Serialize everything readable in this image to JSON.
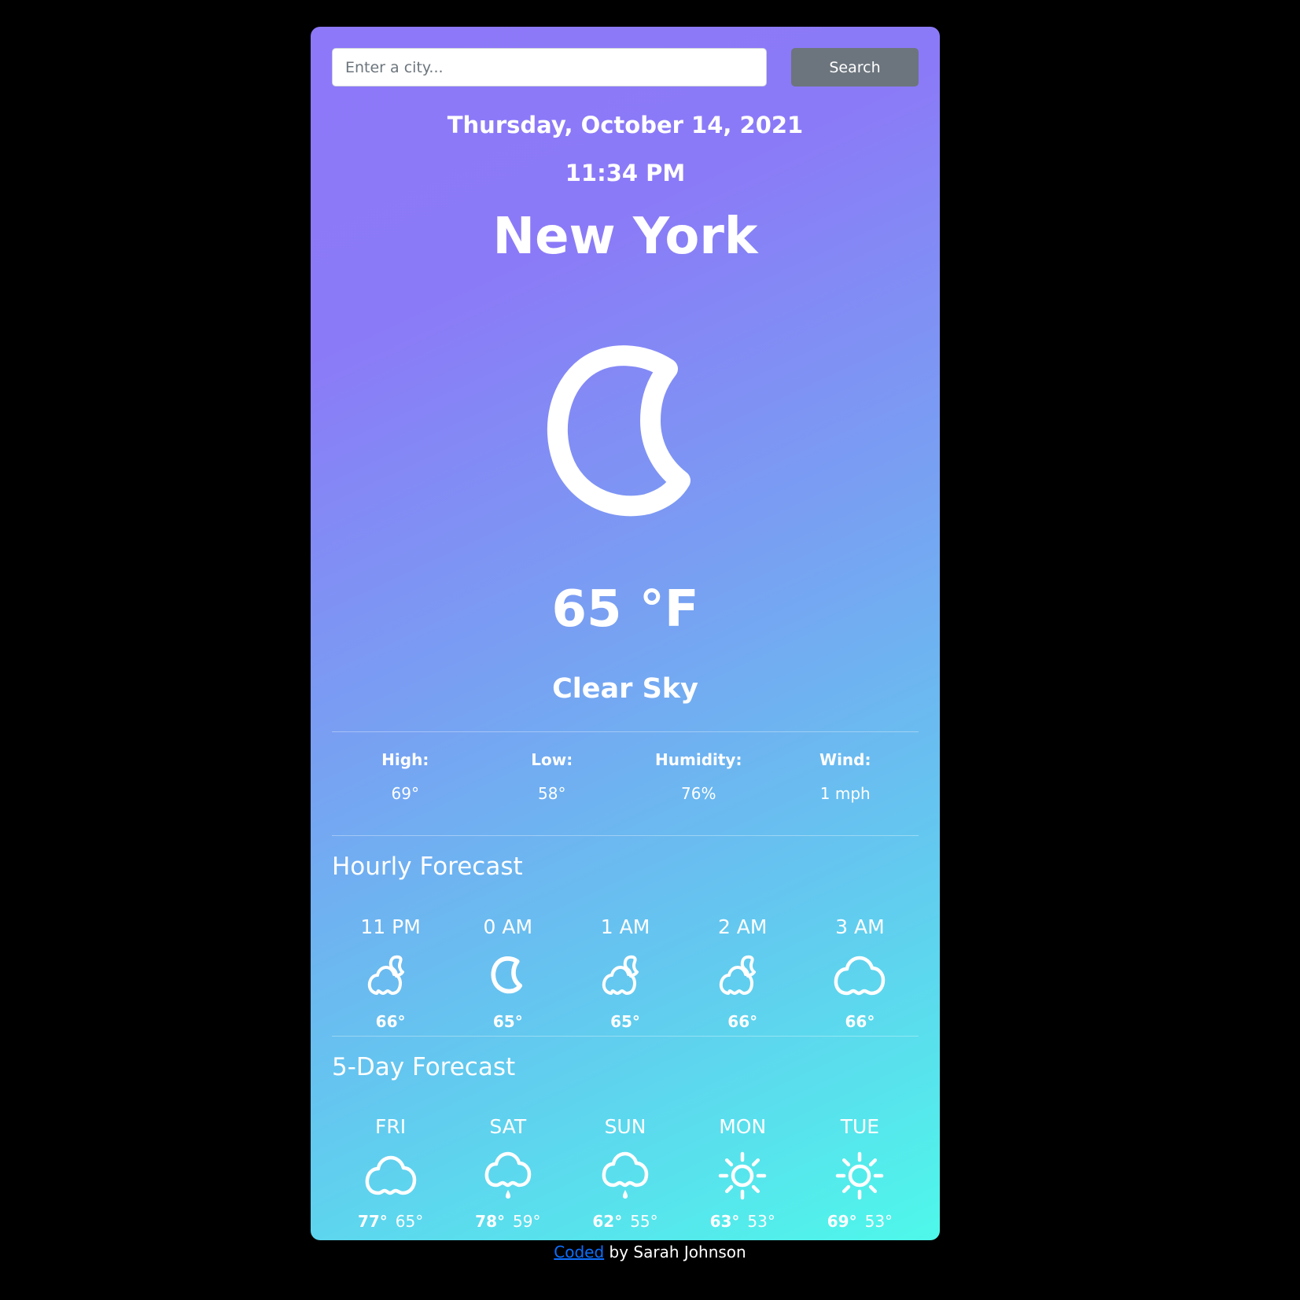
{
  "search": {
    "placeholder": "Enter a city...",
    "value": "",
    "button_label": "Search"
  },
  "current": {
    "date": "Thursday, October 14, 2021",
    "time": "11:34 PM",
    "city": "New York",
    "icon": "moon-icon",
    "temperature": "65 °F",
    "description": "Clear Sky"
  },
  "stats": [
    {
      "label": "High:",
      "value": "69°"
    },
    {
      "label": "Low:",
      "value": "58°"
    },
    {
      "label": "Humidity:",
      "value": "76%"
    },
    {
      "label": "Wind:",
      "value": "1 mph"
    }
  ],
  "hourly": {
    "title": "Hourly Forecast",
    "items": [
      {
        "time": "11 PM",
        "icon": "cloud-moon-icon",
        "temp": "66°"
      },
      {
        "time": "0 AM",
        "icon": "moon-icon",
        "temp": "65°"
      },
      {
        "time": "1 AM",
        "icon": "cloud-moon-icon",
        "temp": "65°"
      },
      {
        "time": "2 AM",
        "icon": "cloud-moon-icon",
        "temp": "66°"
      },
      {
        "time": "3 AM",
        "icon": "cloud-icon",
        "temp": "66°"
      }
    ]
  },
  "daily": {
    "title": "5-Day Forecast",
    "items": [
      {
        "day": "FRI",
        "icon": "cloud-icon",
        "high": "77°",
        "low": "65°"
      },
      {
        "day": "SAT",
        "icon": "rain-cloud-icon",
        "high": "78°",
        "low": "59°"
      },
      {
        "day": "SUN",
        "icon": "rain-cloud-icon",
        "high": "62°",
        "low": "55°"
      },
      {
        "day": "MON",
        "icon": "sun-icon",
        "high": "63°",
        "low": "53°"
      },
      {
        "day": "TUE",
        "icon": "sun-icon",
        "high": "69°",
        "low": "53°"
      }
    ]
  },
  "footer": {
    "link_text": "Coded",
    "text": " by Sarah Johnson"
  },
  "colors": {
    "gradient_start": "#8c78f8",
    "gradient_end": "#4ef8ea",
    "button": "#6c757d",
    "link": "#0d6efd"
  }
}
